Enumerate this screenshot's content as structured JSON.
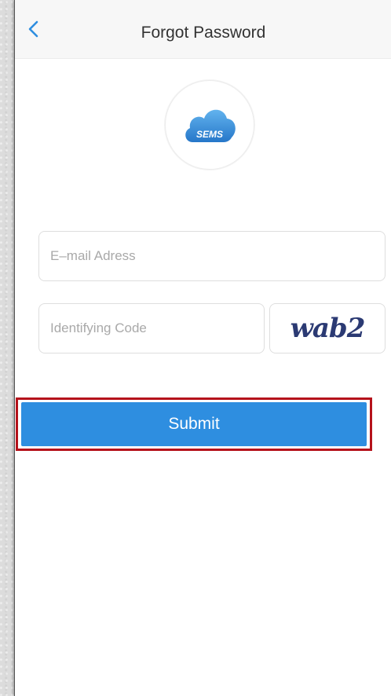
{
  "header": {
    "title": "Forgot Password",
    "back_icon": "chevron-left-icon",
    "accent_color": "#2e8ee0"
  },
  "logo": {
    "text": "SEMS",
    "icon": "cloud-logo-icon",
    "color": "#3b8fd8"
  },
  "form": {
    "email": {
      "value": "",
      "placeholder": "E–mail Adress"
    },
    "code": {
      "value": "",
      "placeholder": "Identifying Code"
    },
    "captcha_text": "wab2"
  },
  "actions": {
    "submit_label": "Submit",
    "submit_color": "#2e8ee0",
    "highlight_color": "#b5121b"
  }
}
